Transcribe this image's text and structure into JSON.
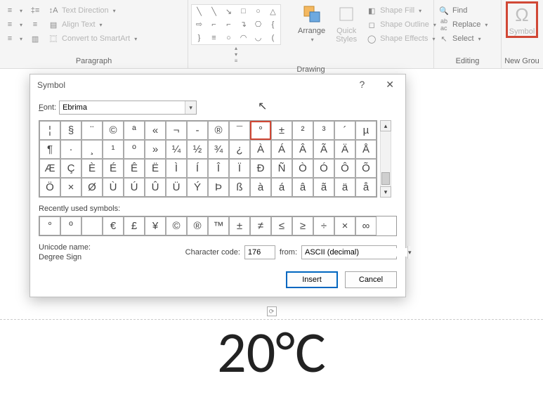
{
  "ribbon": {
    "paragraph": {
      "title": "Paragraph",
      "text_direction": "Text Direction",
      "align_text": "Align Text",
      "convert_smartart": "Convert to SmartArt"
    },
    "drawing": {
      "title": "Drawing",
      "arrange": "Arrange",
      "quick_styles": "Quick\nStyles",
      "shape_fill": "Shape Fill",
      "shape_outline": "Shape Outline",
      "shape_effects": "Shape Effects"
    },
    "editing": {
      "title": "Editing",
      "find": "Find",
      "replace": "Replace",
      "select": "Select"
    },
    "new_group": {
      "title": "New Grou",
      "symbol": "Symbol"
    }
  },
  "shapes_glyphs": [
    "╲",
    "╲",
    "↘",
    "□",
    "○",
    "△",
    "⇨",
    "⌐",
    "⌐",
    "↴",
    "⎔",
    "{",
    "}",
    "≡",
    "○",
    "◠",
    "◡",
    "(",
    ")",
    "⌒",
    "△",
    "▢",
    "⌂",
    "⇘"
  ],
  "dialog": {
    "title": "Symbol",
    "font_label": "Font:",
    "font_value": "Ebrima",
    "recent_label": "Recently used symbols:",
    "unicode_name_label": "Unicode name:",
    "unicode_name_value": "Degree Sign",
    "char_code_label": "Character code:",
    "char_code_value": "176",
    "from_label": "from:",
    "from_value": "ASCII (decimal)",
    "insert": "Insert",
    "cancel": "Cancel"
  },
  "symbol_grid": [
    [
      "¦",
      "§",
      "¨",
      "©",
      "ª",
      "«",
      "¬",
      "­-",
      "®",
      "¯",
      "°",
      "±",
      "²",
      "³",
      "´",
      "µ"
    ],
    [
      "¶",
      "·",
      "¸",
      "¹",
      "º",
      "»",
      "¼",
      "½",
      "¾",
      "¿",
      "À",
      "Á",
      "Â",
      "Ã",
      "Ä",
      "Å"
    ],
    [
      "Æ",
      "Ç",
      "È",
      "É",
      "Ê",
      "Ë",
      "Ì",
      "Í",
      "Î",
      "Ï",
      "Ð",
      "Ñ",
      "Ò",
      "Ó",
      "Ô",
      "Õ"
    ],
    [
      "Ö",
      "×",
      "Ø",
      "Ù",
      "Ú",
      "Û",
      "Ü",
      "Ý",
      "Þ",
      "ß",
      "à",
      "á",
      "â",
      "ã",
      "ä",
      "å"
    ]
  ],
  "selected_symbol_index": [
    0,
    10
  ],
  "recent_symbols": [
    "°",
    "º",
    "",
    "€",
    "£",
    "¥",
    "©",
    "®",
    "™",
    "±",
    "≠",
    "≤",
    "≥",
    "÷",
    "×",
    "∞"
  ],
  "document_text": "20°C"
}
